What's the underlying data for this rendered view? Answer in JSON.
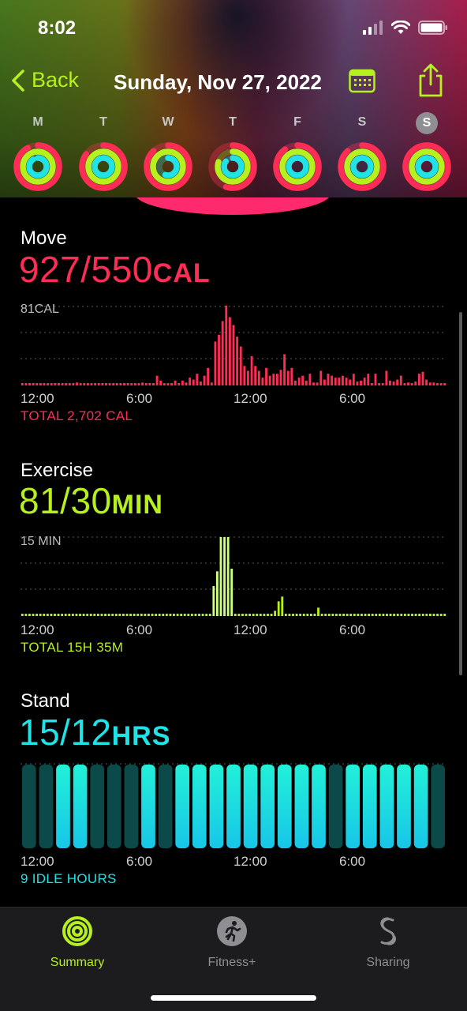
{
  "status": {
    "time": "8:02"
  },
  "nav": {
    "back_label": "Back",
    "title": "Sunday, Nov 27, 2022"
  },
  "week": {
    "days": [
      "M",
      "T",
      "W",
      "T",
      "F",
      "S",
      "S"
    ],
    "selected_index": 6
  },
  "move": {
    "title": "Move",
    "value": "927/550",
    "unit": "CAL",
    "y_max_label": "81CAL",
    "total": "TOTAL 2,702 CAL",
    "color": "#ff2d55"
  },
  "exercise": {
    "title": "Exercise",
    "value": "81/30",
    "unit": "MIN",
    "y_max_label": "15 MIN",
    "total": "TOTAL 15H 35M",
    "color": "#b6f01e"
  },
  "stand": {
    "title": "Stand",
    "value": "15/12",
    "unit": "HRS",
    "total": "9 IDLE HOURS",
    "color": "#1fe3e6"
  },
  "x_axis": [
    "12:00",
    "6:00",
    "12:00",
    "6:00"
  ],
  "chart_data": [
    {
      "type": "bar",
      "title": "Move",
      "ylabel": "CAL",
      "ylim": [
        0,
        81
      ],
      "x_ticks": [
        "12:00",
        "6:00",
        "12:00",
        "6:00"
      ],
      "values": [
        2,
        2,
        2,
        2,
        2,
        2,
        2,
        2,
        2,
        2,
        2,
        2,
        2,
        2,
        2,
        3,
        2,
        2,
        2,
        2,
        2,
        2,
        2,
        2,
        2,
        2,
        2,
        2,
        2,
        2,
        2,
        2,
        2,
        3,
        2,
        2,
        2,
        10,
        5,
        2,
        2,
        2,
        5,
        2,
        5,
        3,
        8,
        6,
        12,
        4,
        10,
        18,
        3,
        45,
        52,
        66,
        82,
        70,
        62,
        50,
        40,
        20,
        15,
        30,
        20,
        15,
        8,
        18,
        10,
        12,
        12,
        16,
        32,
        15,
        18,
        5,
        8,
        10,
        5,
        12,
        3,
        3,
        15,
        6,
        12,
        10,
        8,
        8,
        10,
        8,
        6,
        12,
        4,
        5,
        8,
        12,
        2,
        12,
        2,
        2,
        15,
        5,
        4,
        6,
        10,
        2,
        3,
        2,
        4,
        12,
        14,
        6,
        3,
        3,
        2,
        2,
        2
      ],
      "total": "TOTAL 2,702 CAL"
    },
    {
      "type": "bar",
      "title": "Exercise",
      "ylabel": "MIN",
      "ylim": [
        0,
        15
      ],
      "x_ticks": [
        "12:00",
        "6:00",
        "12:00",
        "6:00"
      ],
      "values": [
        0,
        0,
        0,
        0,
        0,
        0,
        0,
        0,
        0,
        0,
        0,
        0,
        0,
        0,
        0,
        0,
        0,
        0,
        0,
        0,
        0,
        0,
        0,
        0,
        0,
        0,
        0,
        0,
        0,
        0,
        0,
        0,
        0,
        0,
        0,
        0,
        0,
        0,
        0,
        0,
        0,
        0,
        0,
        0,
        0,
        0,
        0,
        0,
        0,
        0,
        0,
        0,
        0,
        5.7,
        8.5,
        15,
        15,
        15,
        9,
        0,
        0,
        0,
        0,
        0,
        0,
        0,
        0,
        0.3,
        0.4,
        0.4,
        1,
        2.8,
        3.7,
        0,
        0,
        0,
        0,
        0,
        0,
        0,
        0,
        0,
        1.6,
        0,
        0,
        0,
        0,
        0,
        0,
        0,
        0,
        0,
        0,
        0,
        0,
        0,
        0,
        0,
        0,
        0,
        0,
        0,
        0,
        0,
        0,
        0,
        0,
        0,
        0,
        0,
        0,
        0,
        0,
        0,
        0,
        0,
        0,
        0
      ],
      "total": "TOTAL 15H 35M"
    },
    {
      "type": "bar",
      "title": "Stand",
      "ylabel": "HRS",
      "x_ticks": [
        "12:00",
        "6:00",
        "12:00",
        "6:00"
      ],
      "values": [
        0,
        0,
        1,
        1,
        0,
        0,
        0,
        1,
        0,
        1,
        1,
        1,
        1,
        1,
        1,
        1,
        1,
        1,
        0,
        1,
        1,
        1,
        1,
        1,
        0
      ],
      "total": "9 IDLE HOURS"
    }
  ],
  "tabs": [
    {
      "label": "Summary",
      "active": true
    },
    {
      "label": "Fitness+",
      "active": false
    },
    {
      "label": "Sharing",
      "active": false
    }
  ]
}
